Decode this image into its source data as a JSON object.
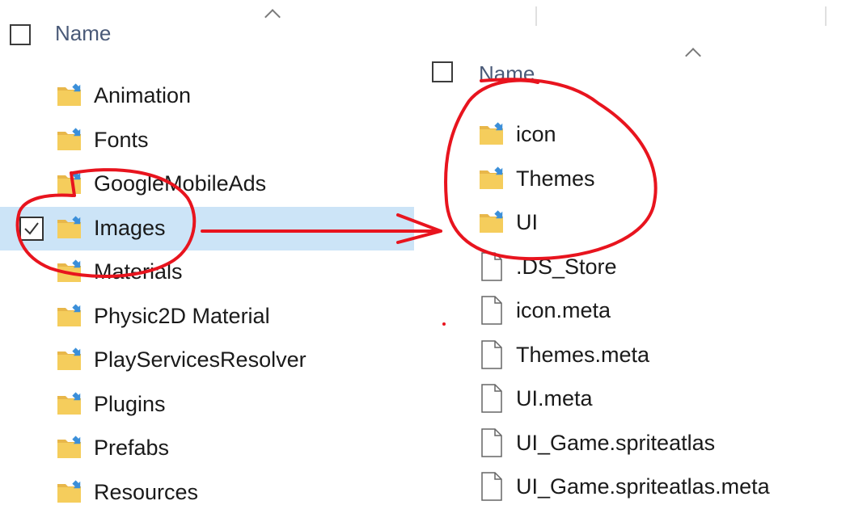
{
  "left_pane": {
    "header": {
      "name_label": "Name"
    },
    "items": [
      {
        "label": "Animation",
        "type": "folder",
        "selected": false
      },
      {
        "label": "Fonts",
        "type": "folder",
        "selected": false
      },
      {
        "label": "GoogleMobileAds",
        "type": "folder",
        "selected": false
      },
      {
        "label": "Images",
        "type": "folder",
        "selected": true
      },
      {
        "label": "Materials",
        "type": "folder",
        "selected": false
      },
      {
        "label": "Physic2D Material",
        "type": "folder",
        "selected": false
      },
      {
        "label": "PlayServicesResolver",
        "type": "folder",
        "selected": false
      },
      {
        "label": "Plugins",
        "type": "folder",
        "selected": false
      },
      {
        "label": "Prefabs",
        "type": "folder",
        "selected": false
      },
      {
        "label": "Resources",
        "type": "folder",
        "selected": false
      }
    ]
  },
  "right_pane": {
    "header": {
      "name_label": "Name"
    },
    "items": [
      {
        "label": "icon",
        "type": "folder"
      },
      {
        "label": "Themes",
        "type": "folder"
      },
      {
        "label": "UI",
        "type": "folder"
      },
      {
        "label": ".DS_Store",
        "type": "file"
      },
      {
        "label": "icon.meta",
        "type": "file"
      },
      {
        "label": "Themes.meta",
        "type": "file"
      },
      {
        "label": "UI.meta",
        "type": "file"
      },
      {
        "label": "UI_Game.spriteatlas",
        "type": "file"
      },
      {
        "label": "UI_Game.spriteatlas.meta",
        "type": "file"
      }
    ]
  },
  "colors": {
    "selection": "#cce4f7",
    "annotation": "#e8141e",
    "header_text": "#4a5a78"
  },
  "icons": {
    "folder": "pinned-folder-icon",
    "file": "file-icon",
    "check": "checkmark-icon"
  }
}
